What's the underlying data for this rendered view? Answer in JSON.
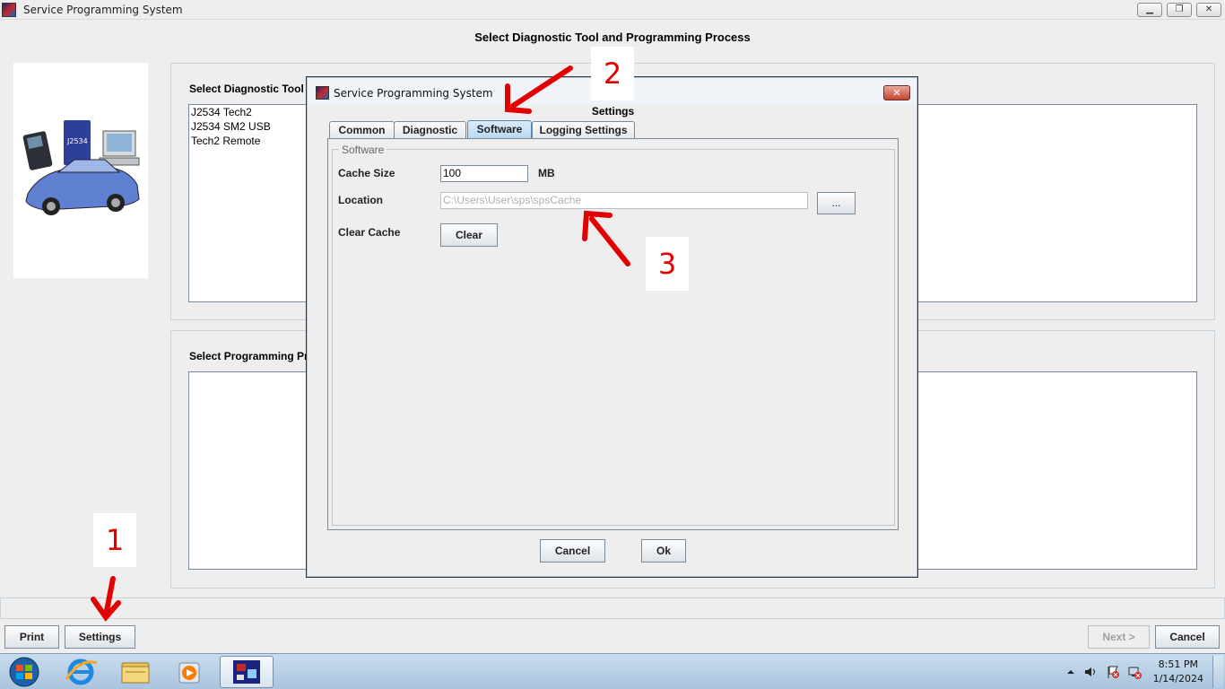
{
  "window": {
    "title": "Service Programming System",
    "controls": [
      "minimize",
      "restore",
      "close"
    ]
  },
  "main": {
    "heading": "Select Diagnostic Tool and Programming Process",
    "diagnostic_tool_label": "Select Diagnostic Tool",
    "diagnostic_tools": [
      "J2534 Tech2",
      "J2534 SM2 USB",
      "Tech2 Remote"
    ],
    "programming_process_label": "Select Programming Pr",
    "logo_text": "J2534"
  },
  "bottom_buttons": {
    "print": "Print",
    "settings": "Settings",
    "next": "Next >",
    "cancel": "Cancel"
  },
  "dialog": {
    "title": "Service Programming System",
    "heading": "Settings",
    "close_label": "✕",
    "tabs": [
      {
        "label": "Common",
        "selected": false
      },
      {
        "label": "Diagnostic",
        "selected": false
      },
      {
        "label": "Software",
        "selected": true
      },
      {
        "label": "Logging Settings",
        "selected": false
      }
    ],
    "section_title": "Software",
    "cache_size": {
      "label": "Cache Size",
      "value": "100",
      "unit": "MB"
    },
    "location": {
      "label": "Location",
      "value": "C:\\Users\\User\\sps\\spsCache",
      "browse_label": "..."
    },
    "clear_cache": {
      "label": "Clear Cache",
      "button": "Clear"
    },
    "buttons": {
      "cancel": "Cancel",
      "ok": "Ok"
    }
  },
  "annotations": [
    {
      "number": "1"
    },
    {
      "number": "2"
    },
    {
      "number": "3"
    }
  ],
  "taskbar": {
    "items": [
      "start-orb",
      "internet-explorer",
      "file-explorer",
      "media-player",
      "service-programming-system"
    ],
    "time": "8:51 PM",
    "date": "1/14/2024"
  },
  "colors": {
    "annotation": "#e30000",
    "selected_tab": "#b5d6f3",
    "dialog_close": "#c6452c"
  }
}
